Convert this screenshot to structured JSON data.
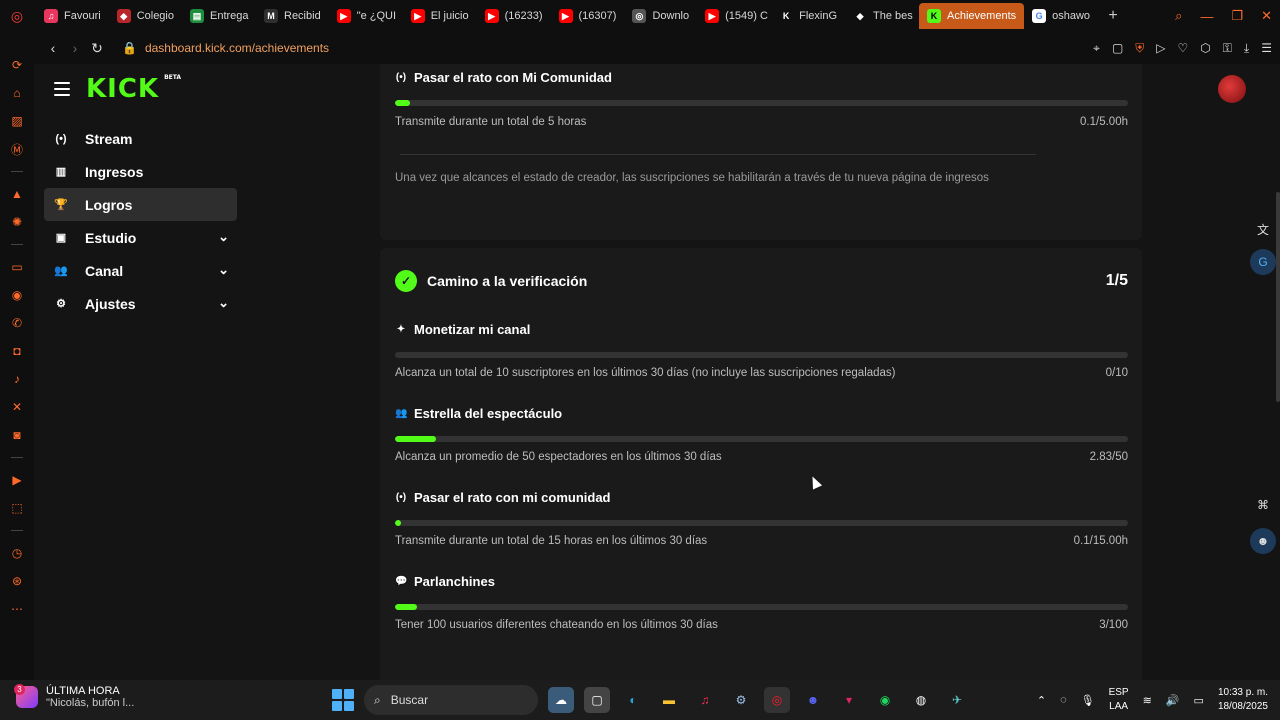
{
  "browser": {
    "tabs": [
      {
        "label": "Favouri",
        "fav_color": "#e8365d",
        "fav_glyph": "♫"
      },
      {
        "label": "Colegio",
        "fav_color": "#b8262c",
        "fav_glyph": "◆"
      },
      {
        "label": "Entrega",
        "fav_color": "#1e8e3e",
        "fav_glyph": "▤"
      },
      {
        "label": "Recibid",
        "fav_color": "#2f2f2f",
        "fav_glyph": "M"
      },
      {
        "label": "\"e ¿QUI",
        "fav_color": "#ff0000",
        "fav_glyph": "▶"
      },
      {
        "label": "El juicio",
        "fav_color": "#ff0000",
        "fav_glyph": "▶"
      },
      {
        "label": "(16233)",
        "fav_color": "#ff0000",
        "fav_glyph": "▶"
      },
      {
        "label": "(16307)",
        "fav_color": "#ff0000",
        "fav_glyph": "▶"
      },
      {
        "label": "Downlo",
        "fav_color": "#555555",
        "fav_glyph": "◎"
      },
      {
        "label": "(1549) C",
        "fav_color": "#ff0000",
        "fav_glyph": "▶"
      },
      {
        "label": "FlexinG",
        "fav_color": "#0f0f0f",
        "fav_glyph": "K"
      },
      {
        "label": "The bes",
        "fav_color": "#0f0f0f",
        "fav_glyph": "◆"
      },
      {
        "label": "Achievements",
        "fav_color": "#53fc18",
        "fav_glyph": "K",
        "active": true
      },
      {
        "label": "oshawo",
        "fav_color": "#ffffff",
        "fav_glyph": "G"
      }
    ],
    "url": "dashboard.kick.com/achievements"
  },
  "kick": {
    "logo": "KICK",
    "beta": "BETA"
  },
  "sidebar": {
    "items": [
      {
        "label": "Stream",
        "icon": "(•)"
      },
      {
        "label": "Ingresos",
        "icon": "▥"
      },
      {
        "label": "Logros",
        "icon": "🏆",
        "active": true
      },
      {
        "label": "Estudio",
        "icon": "▣",
        "chevron": true
      },
      {
        "label": "Canal",
        "icon": "👥",
        "chevron": true
      },
      {
        "label": "Ajustes",
        "icon": "⚙",
        "chevron": true
      }
    ]
  },
  "card1": {
    "title": "Pasar el rato con Mi Comunidad",
    "progress_fraction": 0.02,
    "description": "Transmite durante un total de 5 horas",
    "progress_text": "0.1/5.00h",
    "note": "Una vez que alcances el estado de creador, las suscripciones se habilitarán a través de tu nueva página de ingresos"
  },
  "verification": {
    "title": "Camino a la verificación",
    "count": "1/5",
    "items": [
      {
        "title": "Monetizar mi canal",
        "icon": "✦",
        "fraction": 0.0,
        "description": "Alcanza un total de 10 suscriptores en los últimos 30 días (no incluye las suscripciones regaladas)",
        "progress": "0/10"
      },
      {
        "title": "Estrella del espectáculo",
        "icon": "👥",
        "fraction": 0.0566,
        "description": "Alcanza un promedio de 50 espectadores en los últimos 30 días",
        "progress": "2.83/50"
      },
      {
        "title": "Pasar el rato con mi comunidad",
        "icon": "(•)",
        "fraction": 0.007,
        "description": "Transmite durante un total de 15 horas en los últimos 30 días",
        "progress": "0.1/15.00h"
      },
      {
        "title": "Parlanchines",
        "icon": "💬",
        "fraction": 0.03,
        "description": "Tener 100 usuarios diferentes chateando en los últimos 30 días",
        "progress": "3/100"
      }
    ]
  },
  "taskbar": {
    "news_title": "ÚLTIMA HORA",
    "news_sub": "\"Nicolás, bufón l...",
    "news_count": "3",
    "search": "Buscar",
    "lang1": "ESP",
    "lang2": "LAA",
    "time": "10:33 p. m.",
    "date": "18/08/2025"
  },
  "colors": {
    "accent_green": "#53fc18",
    "browser_accent": "#ff6a2a"
  }
}
